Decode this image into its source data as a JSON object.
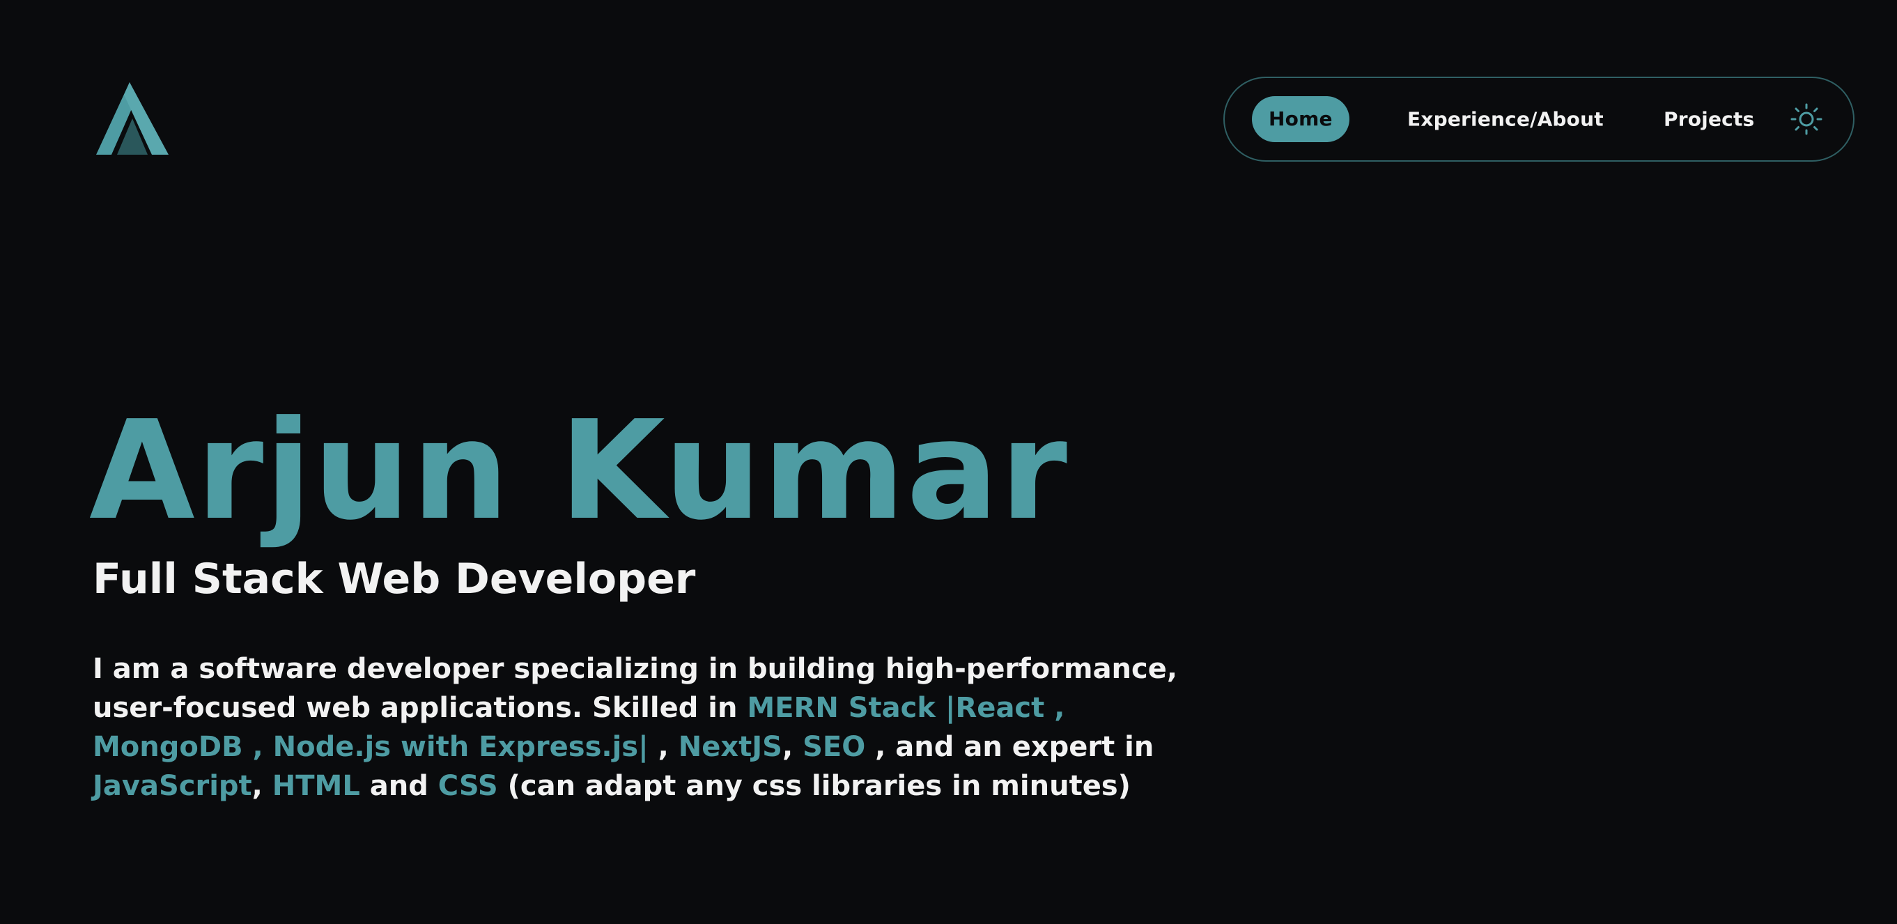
{
  "logo": {
    "icon": "logo-a-icon",
    "color": "#4e9ca3"
  },
  "nav": {
    "items": [
      {
        "label": "Home",
        "active": true
      },
      {
        "label": "Experience/About",
        "active": false
      },
      {
        "label": "Projects",
        "active": false
      }
    ],
    "theme_toggle_icon": "sun-icon",
    "border_color": "#2f5f63",
    "accent": "#4e9ca3"
  },
  "hero": {
    "name": "Arjun Kumar",
    "role": "Full Stack Web Developer",
    "bio": {
      "t1": "I am a software developer specializing in building high-performance, user-focused web applications. Skilled in ",
      "h1": "MERN Stack |React , MongoDB , Node.js with Express.js|",
      "t2": " , ",
      "h2": "NextJS",
      "t3": ", ",
      "h3": "SEO",
      "t4": " , and an expert in ",
      "h4": "JavaScript",
      "t5": ", ",
      "h5": "HTML",
      "t6": " and ",
      "h6": "CSS",
      "t7": " (can adapt any css libraries in minutes)"
    }
  },
  "colors": {
    "background": "#0a0b0d",
    "accent": "#4e9ca3",
    "text": "#f2f2f2"
  }
}
